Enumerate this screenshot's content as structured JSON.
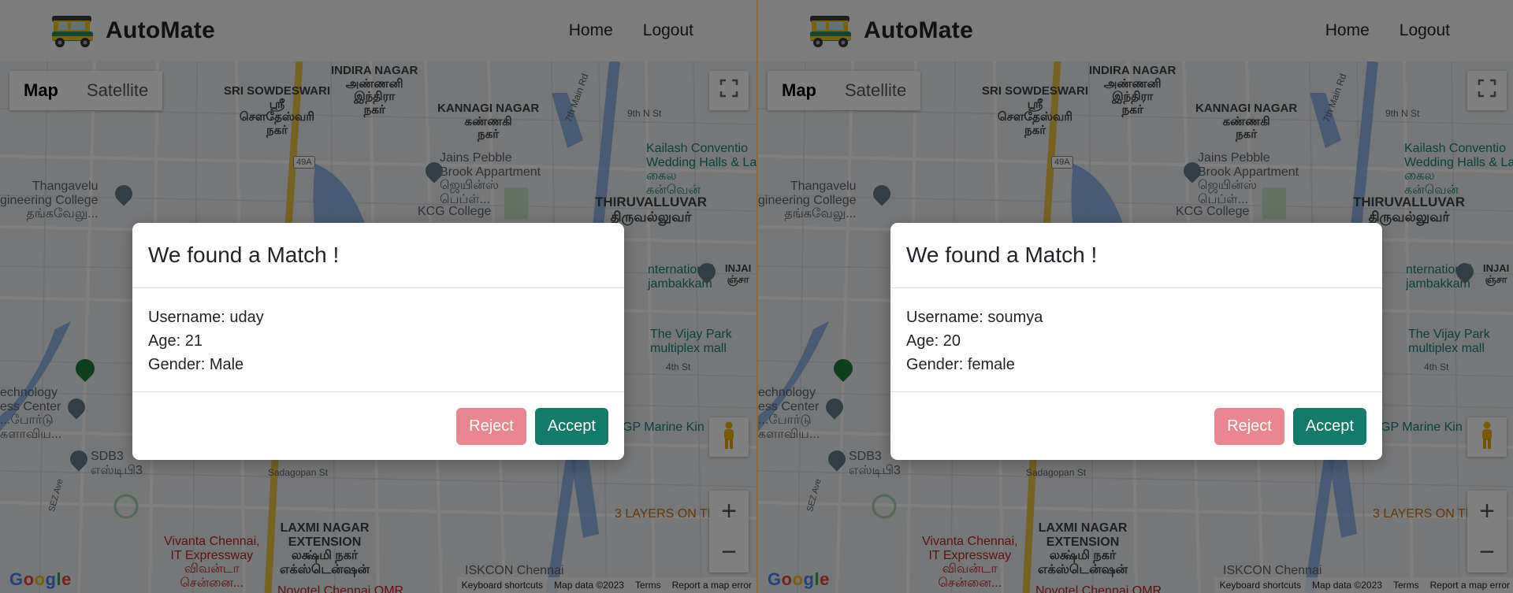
{
  "panes": [
    {
      "nav": {
        "brand": "AutoMate",
        "home": "Home",
        "logout": "Logout"
      },
      "map": {
        "type_map": "Map",
        "type_satellite": "Satellite",
        "fullscreen_icon": "fullscreen-icon",
        "zoom_in": "+",
        "zoom_out": "−",
        "google": "Google",
        "attr_shortcuts": "Keyboard shortcuts",
        "attr_data": "Map data ©2023",
        "attr_terms": "Terms",
        "attr_report": "Report a map error",
        "labels": {
          "indira": "INDIRA NAGAR\nஅண்ணனி\nஇந்திரா\nநகர்",
          "sowdeswari": "SRI SOWDESWARI\nஸ்ரீ\nசௌதேஸ்வரி\nநகர்",
          "kannagi": "KANNAGI NAGAR\nகண்ணகி\nநகர்",
          "hw": "49A",
          "main_rd": "7th Main Rd",
          "ninth_st": "9th N St",
          "kailash": "Kailash Conventio\nWedding Halls & La\nகைல\nகன்வென்",
          "jains": "Jains Pebble\nBrook Appartment\nஜெயின்ஸ்\nபெப்ள்...",
          "thangavelu": "Thangavelu\ngineering College\nதங்கவேலு...",
          "kcg": "KCG College",
          "thiru": "THIRUVALLUVAR\nதிருவல்லுவர்",
          "intl": "nternational\njambakkam",
          "injam": "INJAI\nஞ்சா",
          "vijay": "The Vijay Park\nmultiplex mall",
          "fourth_st": "4th St",
          "tech": "echnology\ness Center\n...போர்டு\nகளாவிய...",
          "gp_marine": "GP Marine Kin",
          "sdb3": "SDB3\nஎஸ்டிபி3",
          "sadagopan": "Sadagopan St",
          "sez": "SEZ Ave",
          "three_layers": "3 LAYERS ON TI",
          "vivanta": "Vivanta Chennai,\nIT Expressway\nவிவன்டா\nசென்னை...",
          "laxmi": "LAXMI NAGAR\nEXTENSION\nலக்ஷ்மி நகர்\nஎக்ஸ்டென்ஷன்",
          "iskcon": "ISKCON Chennai",
          "novotel": "Novotel Chennai OMR"
        }
      },
      "modal": {
        "title": "We found a Match !",
        "username": "Username: uday",
        "age": "Age: 21",
        "gender": "Gender: Male",
        "reject": "Reject",
        "accept": "Accept"
      }
    },
    {
      "nav": {
        "brand": "AutoMate",
        "home": "Home",
        "logout": "Logout"
      },
      "map": {
        "type_map": "Map",
        "type_satellite": "Satellite",
        "fullscreen_icon": "fullscreen-icon",
        "zoom_in": "+",
        "zoom_out": "−",
        "google": "Google",
        "attr_shortcuts": "Keyboard shortcuts",
        "attr_data": "Map data ©2023",
        "attr_terms": "Terms",
        "attr_report": "Report a map error",
        "labels": {
          "indira": "INDIRA NAGAR\nஅண்ணனி\nஇந்திரா\nநகர்",
          "sowdeswari": "SRI SOWDESWARI\nஸ்ரீ\nசௌதேஸ்வரி\nநகர்",
          "kannagi": "KANNAGI NAGAR\nகண்ணகி\nநகர்",
          "hw": "49A",
          "main_rd": "7th Main Rd",
          "ninth_st": "9th N St",
          "kailash": "Kailash Conventio\nWedding Halls & La\nகைல\nகன்வென்",
          "jains": "Jains Pebble\nBrook Appartment\nஜெயின்ஸ்\nபெப்ள்...",
          "thangavelu": "Thangavelu\ngineering College\nதங்கவேலு...",
          "kcg": "KCG College",
          "thiru": "THIRUVALLUVAR\nதிருவல்லுவர்",
          "intl": "nternational\njambakkam",
          "injam": "INJAI\nஞ்சா",
          "vijay": "The Vijay Park\nmultiplex mall",
          "fourth_st": "4th St",
          "tech": "echnology\ness Center\n...போர்டு\nகளாவிய...",
          "gp_marine": "GP Marine Kin",
          "sdb3": "SDB3\nஎஸ்டிபி3",
          "sadagopan": "Sadagopan St",
          "sez": "SEZ Ave",
          "three_layers": "3 LAYERS ON TI",
          "vivanta": "Vivanta Chennai,\nIT Expressway\nவிவன்டா\nசென்னை...",
          "laxmi": "LAXMI NAGAR\nEXTENSION\nலக்ஷ்மி நகர்\nஎக்ஸ்டென்ஷன்",
          "iskcon": "ISKCON Chennai",
          "novotel": "Novotel Chennai OMR"
        }
      },
      "modal": {
        "title": "We found a Match !",
        "username": "Username: soumya",
        "age": "Age: 20",
        "gender": "Gender: female",
        "reject": "Reject",
        "accept": "Accept"
      }
    }
  ]
}
